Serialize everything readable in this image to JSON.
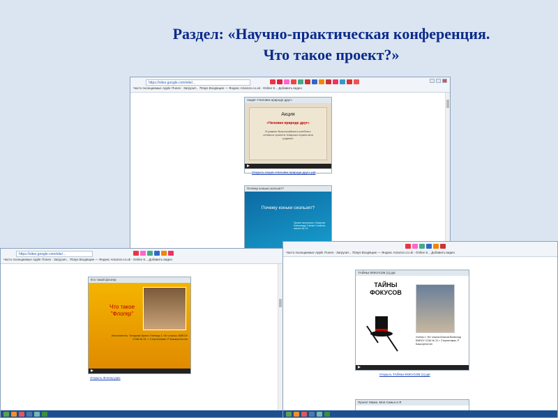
{
  "heading": {
    "line1": "Раздел: «Научно-практическая конференция.",
    "line2": "Что такое проект?»"
  },
  "browser": {
    "url": "https://sites.google.com/site/...",
    "bookmarks": "Часто посещаемые  Apple  iTunes - Загрузит...  7Days  Входящие — Яндекс  Amazon.co.uk - Online S...  Добавить видео"
  },
  "shot1": {
    "card1_head": "Акция «Человек природе друг»",
    "card1_title": "Акция",
    "card1_subtitle": "«Человек природе друг»",
    "card1_text": "В рамках Всероссийского учебного сетевого проекта «Широка страна моя родная»",
    "card1_link": "Открыть Акция «Человек природе друг».ppt",
    "card2_head": "Почему коньки скользят?",
    "card2_title": "Почему коньки скользят?",
    "card2_text": "Проект выполнил: Лоскутов Александр Ученик 4 класса, школы № 10"
  },
  "shot2": {
    "card_head": "Кто такой флогер",
    "slide_title": "Что такое \"Флогер\"",
    "slide_author": "Исполнитель: Татарова Ирина Ученица 1 «А» класса, БМБОУ СОШ № 31, г. Стерлитамак, Р. Башкортостан",
    "link": "Открыть Флогер.pptx"
  },
  "shot3": {
    "card_head": "ТАЙНЫ ФОКУСОВ (1).ppt",
    "slide_title": "ТАЙНЫ ФОКУСОВ",
    "slide_caption": "Ученик 1 «Б» класса Власов Всеволод БМБОУ СОШ № 31 г. Стерлитамак, Р. Башкортостан",
    "link": "Открыть ТАЙНЫ ФОКУСОВ (1).ppt",
    "bottom_head": "Проект Мама, Моя Семья и Я"
  },
  "colors": {
    "heading": "#0b2a8a",
    "bg": "#dbe5f1",
    "taskbar": "#1d4f8f"
  }
}
